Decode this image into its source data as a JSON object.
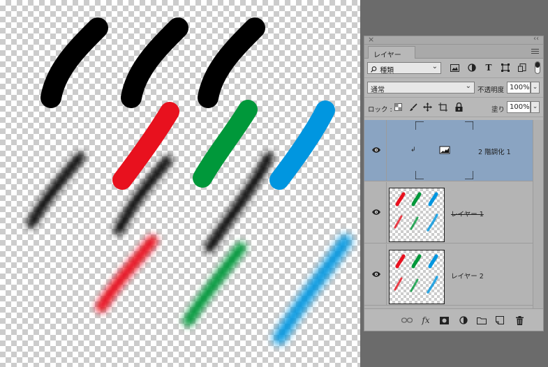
{
  "panel": {
    "close_glyph": "×",
    "collapse_glyph": "‹‹",
    "tab_label": "レイヤー",
    "filter": {
      "kind_label": "種類"
    },
    "blend_mode": "通常",
    "opacity_label": "不透明度 :",
    "opacity_value": "100%",
    "lock_label": "ロック :",
    "fill_label": "塗り :",
    "fill_value": "100%",
    "filter_icons": [
      "image-filter-icon",
      "adjustment-filter-icon",
      "type-filter-icon",
      "shape-filter-icon",
      "smart-object-filter-icon"
    ]
  },
  "layers": [
    {
      "name": "2 階調化 1",
      "type": "adjustment",
      "selected": true,
      "visible": true
    },
    {
      "name": "レイヤー 1",
      "type": "pixel",
      "selected": false,
      "visible": true
    },
    {
      "name": "レイヤー 2",
      "type": "pixel",
      "selected": false,
      "visible": true
    }
  ],
  "bottom_icons": [
    "link-layers-icon",
    "fx-icon",
    "add-mask-icon",
    "new-adjustment-icon",
    "new-group-icon",
    "new-layer-icon",
    "trash-icon"
  ],
  "fx_label": "fx",
  "colors": {
    "red": "#e8111e",
    "green": "#00983a",
    "blue": "#0096e0",
    "black": "#000000",
    "selected_layer": "#8aa4c2",
    "panel_bg": "#b8b8b8"
  }
}
